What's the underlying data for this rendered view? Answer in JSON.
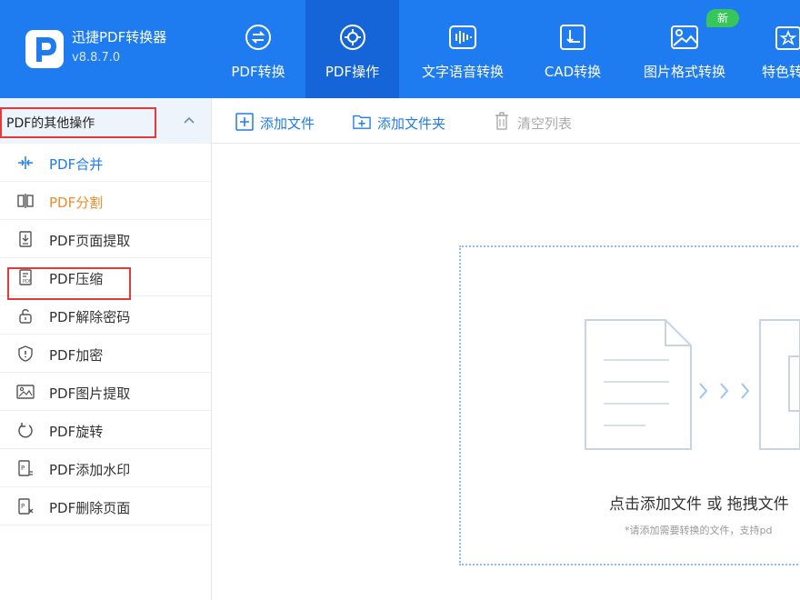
{
  "app": {
    "name": "迅捷PDF转换器",
    "version": "v8.8.7.0"
  },
  "nav": {
    "tabs": [
      {
        "label": "PDF转换",
        "icon": "swap-circle-icon",
        "active": false
      },
      {
        "label": "PDF操作",
        "icon": "gear-circle-icon",
        "active": true
      },
      {
        "label": "文字语音转换",
        "icon": "waveform-icon",
        "active": false
      },
      {
        "label": "CAD转换",
        "icon": "cad-frame-icon",
        "active": false
      },
      {
        "label": "图片格式转换",
        "icon": "image-icon",
        "active": false,
        "badge": "新"
      },
      {
        "label": "特色转",
        "icon": "star-box-icon",
        "active": false
      }
    ]
  },
  "sidebar": {
    "title": "PDF的其他操作",
    "items": [
      {
        "label": "PDF合并",
        "icon": "merge-icon",
        "state": "blue"
      },
      {
        "label": "PDF分割",
        "icon": "split-icon",
        "state": "orange"
      },
      {
        "label": "PDF页面提取",
        "icon": "page-extract-icon",
        "state": "normal"
      },
      {
        "label": "PDF压缩",
        "icon": "compress-icon",
        "state": "normal"
      },
      {
        "label": "PDF解除密码",
        "icon": "unlock-icon",
        "state": "normal"
      },
      {
        "label": "PDF加密",
        "icon": "shield-icon",
        "state": "normal"
      },
      {
        "label": "PDF图片提取",
        "icon": "image-extract-icon",
        "state": "normal"
      },
      {
        "label": "PDF旋转",
        "icon": "rotate-icon",
        "state": "normal"
      },
      {
        "label": "PDF添加水印",
        "icon": "watermark-icon",
        "state": "normal"
      },
      {
        "label": "PDF删除页面",
        "icon": "delete-page-icon",
        "state": "normal"
      }
    ]
  },
  "toolbar": {
    "add_file": "添加文件",
    "add_folder": "添加文件夹",
    "clear_list": "清空列表"
  },
  "drop": {
    "main_text": "点击添加文件 或 拖拽文件",
    "sub_text": "*请添加需要转换的文件，支持pd"
  },
  "colors": {
    "primary": "#1f7bf0",
    "active_tab": "#1565d8",
    "highlight": "#e43a3a",
    "orange": "#f08c2a",
    "badge": "#37c65a"
  }
}
